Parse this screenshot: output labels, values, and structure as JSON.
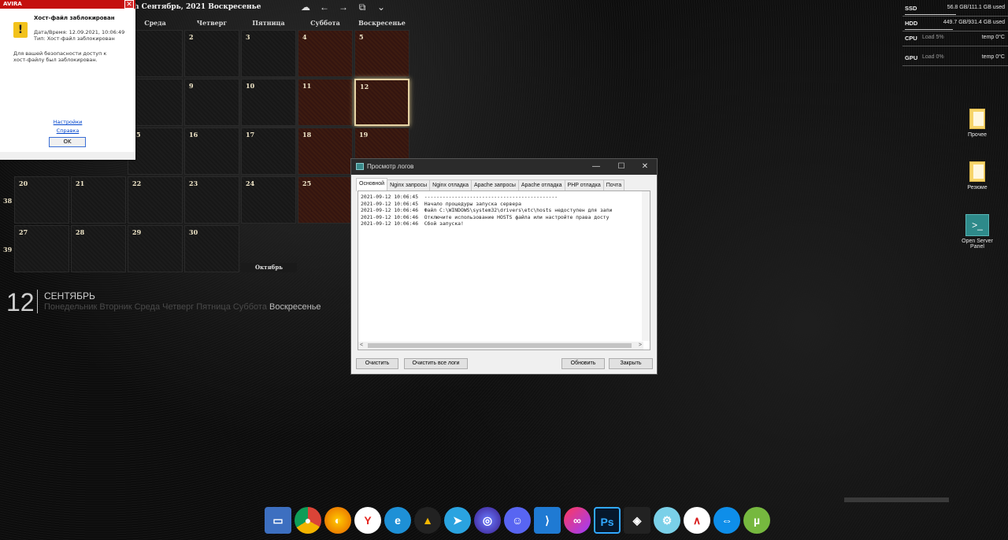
{
  "calendar": {
    "header": "h Сентябрь, 2021 Воскресенье",
    "weekdays": [
      "Среда",
      "Четверг",
      "Пятница",
      "Суббота",
      "Воскресенье"
    ],
    "week_numbers": [
      "38",
      "39"
    ],
    "days": {
      "d2": "2",
      "d3": "3",
      "d4": "4",
      "d5": "5",
      "d9": "9",
      "d10": "10",
      "d11": "11",
      "d12": "12",
      "d5b": "5",
      "d16": "16",
      "d17": "17",
      "d18": "18",
      "d19": "19",
      "d20": "20",
      "d21": "21",
      "d22": "22",
      "d23": "23",
      "d24": "24",
      "d25": "25",
      "d27": "27",
      "d28": "28",
      "d29": "29",
      "d30": "30"
    },
    "next_month": "Октябрь",
    "big_date": "12",
    "big_month": "СЕНТЯБРЬ",
    "big_weekdays_inactive": "Понедельник Вторник Среда Четверг Пятница Суббота ",
    "big_weekday_active": "Воскресенье"
  },
  "avira": {
    "brand": "AVIRA",
    "close": "✕",
    "warn_glyph": "!",
    "title": "Хост-файл заблокирован",
    "datetime": "Дата/Время: 12.09.2021, 10:06:49",
    "type": "Тип: Хост-файл заблокирован",
    "message_1": "Для вашей безопасности доступ к",
    "message_2": "хост-файлу был заблокирован.",
    "link_settings": "Настройки",
    "link_help": "Справка",
    "ok": "OK"
  },
  "log_window": {
    "title": "Просмотр логов",
    "tabs": [
      "Основной",
      "Nginx запросы",
      "Nginx отладка",
      "Apache запросы",
      "Apache отладка",
      "PHP отладка",
      "Почта"
    ],
    "lines": [
      "2021-09-12 10:06:45  --------------------------------------------",
      "2021-09-12 10:06:45  Начало процедуры запуска сервера",
      "2021-09-12 10:06:46  Файл C:\\WINDOWS\\system32\\drivers\\etc\\hosts недоступен для запи",
      "2021-09-12 10:06:46  Отключите использование HOSTS файла или настройте права досту",
      "2021-09-12 10:06:46  Сбой запуска!"
    ],
    "buttons": {
      "clear": "Очистить",
      "clear_all": "Очистить все логи",
      "refresh": "Обновить",
      "close": "Закрыть"
    },
    "controls": {
      "minimize": "—",
      "maximize": "☐",
      "close": "✕"
    }
  },
  "monitor": {
    "ssd_label": "SSD",
    "ssd_value": "56.8 GB/111.1 GB used",
    "hdd_label": "HDD",
    "hdd_value": "449.7 GB/931.4 GB used",
    "cpu_label": "CPU",
    "cpu_load": "Load 5%",
    "cpu_temp": "temp 0°C",
    "gpu_label": "GPU",
    "gpu_load": "Load 0%",
    "gpu_temp": "temp 0°C",
    "ssd_fraction": 0.51,
    "hdd_fraction": 0.48
  },
  "desktop_icons": {
    "other": "Прочее",
    "resume": "Резюме",
    "osp_1": "Open Server",
    "osp_2": "Panel"
  },
  "dock": {
    "apps": [
      "files",
      "chrome",
      "firefox",
      "yandex",
      "ie",
      "artstation",
      "telegram",
      "browser",
      "discord",
      "vscode",
      "creative-cloud",
      "photoshop",
      "figma",
      "settings",
      "avira",
      "teamviewer",
      "utorrent"
    ],
    "ps_label": "Ps"
  }
}
